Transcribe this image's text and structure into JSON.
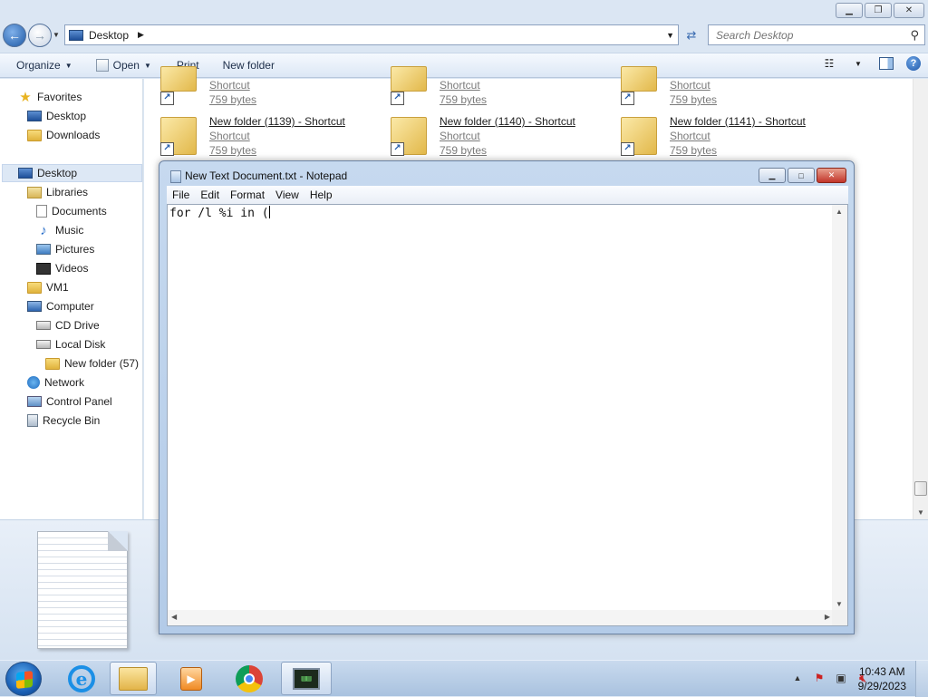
{
  "explorer": {
    "address": {
      "crumb": "Desktop"
    },
    "search": {
      "placeholder": "Search Desktop"
    },
    "toolbar": {
      "organize": "Organize",
      "open": "Open",
      "print": "Print",
      "new_folder": "New folder"
    },
    "nav": [
      {
        "label": "Favorites",
        "icon": "star-icon"
      },
      {
        "label": "Desktop",
        "icon": "desktop-icon"
      },
      {
        "label": "Downloads",
        "icon": "folder-icon"
      },
      {
        "label": "Desktop",
        "icon": "desktop-icon",
        "selected": true
      },
      {
        "label": "Libraries",
        "icon": "library-icon"
      },
      {
        "label": "Documents",
        "icon": "document-icon"
      },
      {
        "label": "Music",
        "icon": "music-icon"
      },
      {
        "label": "Pictures",
        "icon": "pictures-icon"
      },
      {
        "label": "Videos",
        "icon": "videos-icon"
      },
      {
        "label": "VM1",
        "icon": "user-folder-icon"
      },
      {
        "label": "Computer",
        "icon": "computer-icon"
      },
      {
        "label": "CD Drive",
        "icon": "cd-drive-icon"
      },
      {
        "label": "Local Disk",
        "icon": "disk-icon"
      },
      {
        "label": "New folder (57)",
        "icon": "folder-icon"
      },
      {
        "label": "Network",
        "icon": "network-icon"
      },
      {
        "label": "Control Panel",
        "icon": "control-panel-icon"
      },
      {
        "label": "Recycle Bin",
        "icon": "recycle-bin-icon"
      }
    ],
    "files_top": [
      {
        "l2": "Shortcut",
        "l3": "759 bytes"
      },
      {
        "l2": "Shortcut",
        "l3": "759 bytes"
      },
      {
        "l2": "Shortcut",
        "l3": "759 bytes"
      }
    ],
    "files": [
      {
        "name": "New folder (1139) - Shortcut",
        "l2": "Shortcut",
        "l3": "759 bytes"
      },
      {
        "name": "New folder (1140) - Shortcut",
        "l2": "Shortcut",
        "l3": "759 bytes"
      },
      {
        "name": "New folder (1141) - Shortcut",
        "l2": "Shortcut",
        "l3": "759 bytes"
      }
    ]
  },
  "notepad": {
    "title": "New Text Document.txt - Notepad",
    "menu": [
      "File",
      "Edit",
      "Format",
      "View",
      "Help"
    ],
    "content": "for /l %i in ("
  },
  "taskbar": {
    "clock_time": "10:43 AM",
    "clock_date": "9/29/2023",
    "apps": [
      "internet-explorer-icon",
      "file-explorer-icon",
      "media-player-icon",
      "chrome-icon",
      "terminal-icon"
    ]
  }
}
